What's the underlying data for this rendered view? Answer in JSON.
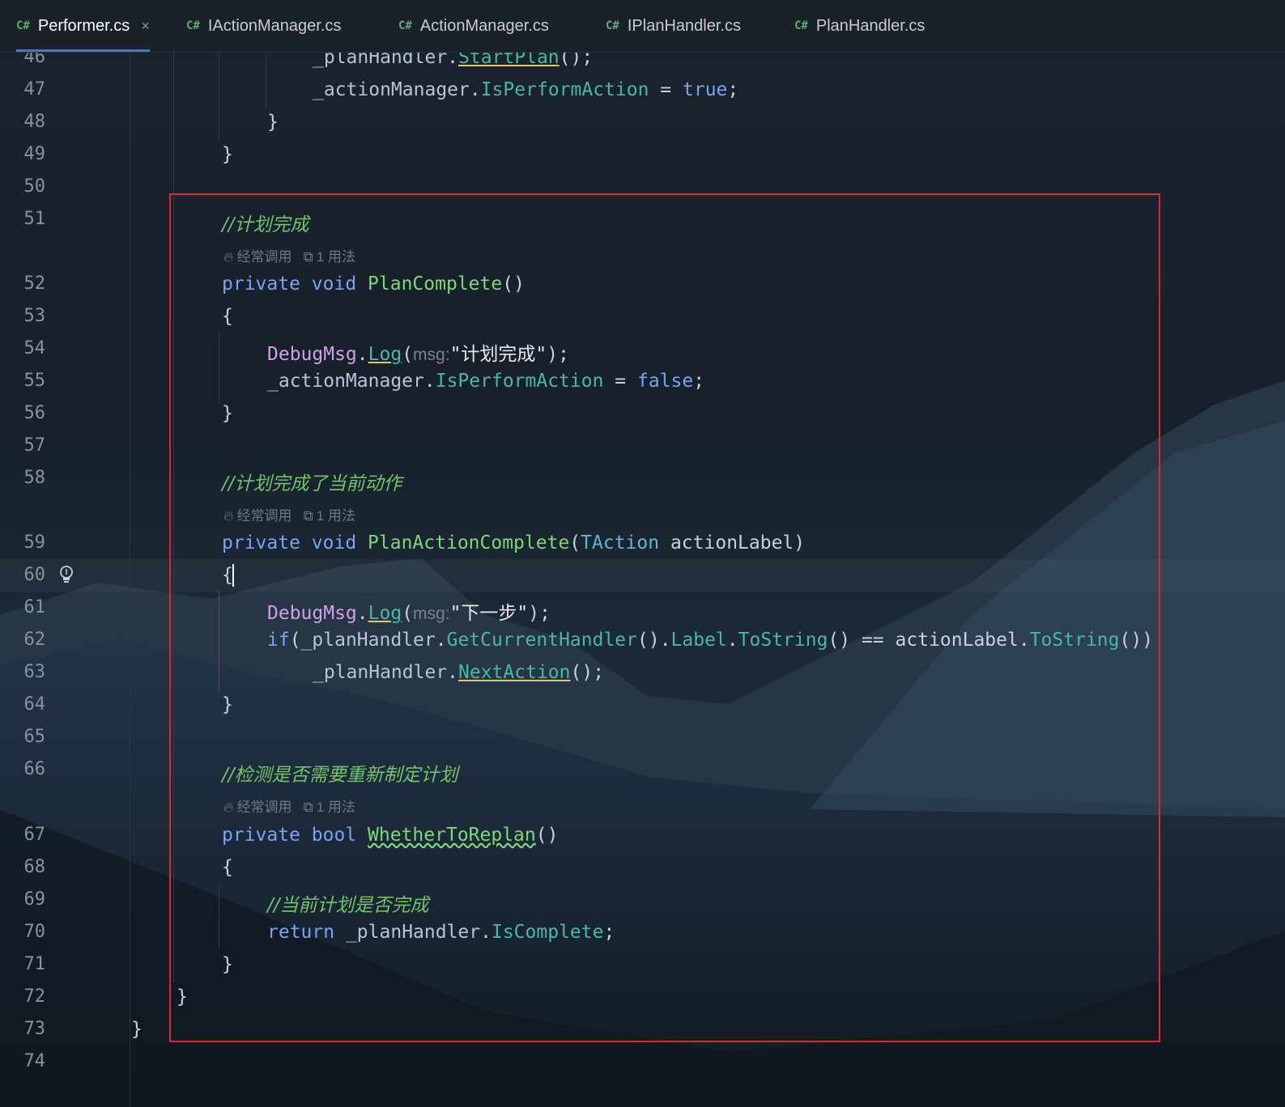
{
  "tabs": [
    {
      "badge": "C#",
      "label": "Performer.cs",
      "active": true,
      "close": "×"
    },
    {
      "badge": "C#",
      "label": "IActionManager.cs"
    },
    {
      "badge": "C#",
      "label": "ActionManager.cs"
    },
    {
      "badge": "C#",
      "label": "IPlanHandler.cs"
    },
    {
      "badge": "C#",
      "label": "PlanHandler.cs"
    }
  ],
  "line_numbers": [
    "46",
    "47",
    "48",
    "49",
    "50",
    "51",
    "52",
    "53",
    "54",
    "55",
    "56",
    "57",
    "58",
    "59",
    "60",
    "61",
    "62",
    "63",
    "64",
    "65",
    "66",
    "67",
    "68",
    "69",
    "70",
    "71",
    "72",
    "73",
    "74"
  ],
  "code": {
    "l46_obj": "_planHandler",
    "l46_m": "StartPlan",
    "l47_obj": "_actionManager",
    "l47_prop": "IsPerformAction",
    "l47_val": "true",
    "c51": "//计划完成",
    "hint_freq": "经常调用",
    "hint_usage": "1 用法",
    "kw_private": "private",
    "kw_void": "void",
    "kw_bool": "bool",
    "kw_if": "if",
    "kw_return": "return",
    "fn1": "PlanComplete",
    "cls_debug": "DebugMsg",
    "m_log": "Log",
    "param_msg": "msg:",
    "s54": "\"计划完成\"",
    "l55_obj": "_actionManager",
    "l55_prop": "IsPerformAction",
    "l55_val": "false",
    "c58": "//计划完成了当前动作",
    "fn2": "PlanActionComplete",
    "type_taction": "TAction",
    "arg_label": "actionLabel",
    "s61": "\"下一步\"",
    "l62_obj": "_planHandler",
    "l62_m1": "GetCurrentHandler",
    "l62_prop": "Label",
    "l62_m2": "ToString",
    "l62_arg": "actionLabel",
    "l62_m3": "ToString",
    "l63_obj": "_planHandler",
    "l63_m": "NextAction",
    "c66": "//检测是否需要重新制定计划",
    "fn3": "WhetherToReplan",
    "c69": "//当前计划是否完成",
    "l70_obj": "_planHandler",
    "l70_prop": "IsComplete"
  },
  "colors": {
    "highlight_box": "#e0262f",
    "active_tab_underline": "#3c78d8"
  },
  "icons": {
    "gutter": "lightbulb-icon",
    "hint_freq": "flame-icon",
    "hint_usage": "usage-link-icon"
  }
}
